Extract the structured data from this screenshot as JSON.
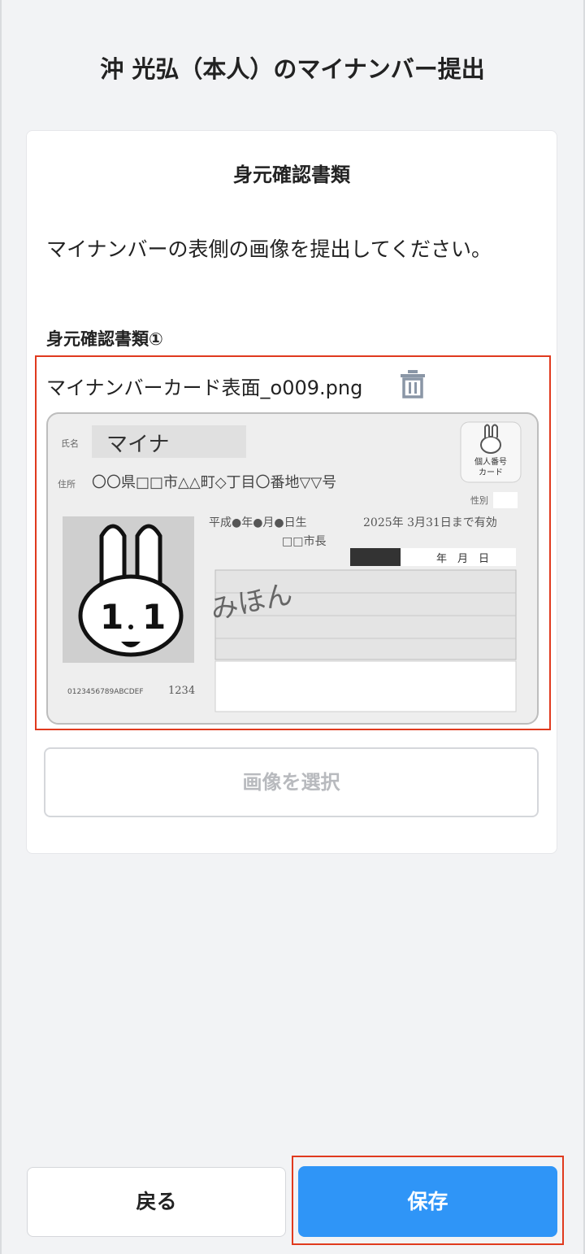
{
  "header": {
    "title": "沖 光弘（本人）のマイナンバー提出"
  },
  "card": {
    "title": "身元確認書類",
    "instruction": "マイナンバーの表側の画像を提出してください。",
    "doc_label": "身元確認書類①",
    "file": {
      "name": "マイナンバーカード表面_o009.png",
      "delete_icon": "trash-icon"
    },
    "id_card": {
      "name_label": "氏名",
      "name_value": "マイナ",
      "address_label": "住所",
      "address_value": "〇〇県□□市△△町◇丁目〇番地▽▽号",
      "card_type_line1": "個人番号",
      "card_type_line2": "カード",
      "sex_label": "性別",
      "birth_line": "平成●年●月●日生",
      "expiry_line": "2025年 3月31日まで有効",
      "issuer": "□□市長",
      "date_labels": "年　月　日",
      "signature": "みほん",
      "serial": "0123456789ABCDEF",
      "code": "1234"
    },
    "select_button": "画像を選択"
  },
  "footer": {
    "back_label": "戻る",
    "save_label": "保存"
  },
  "colors": {
    "primary": "#2f95f7",
    "highlight": "#e03a1e",
    "background": "#f2f3f5"
  }
}
